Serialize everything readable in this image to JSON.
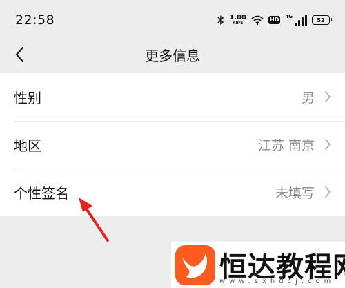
{
  "status_bar": {
    "time": "22:58",
    "net_speed_value": "1.00",
    "net_speed_unit": "KB/S",
    "hd_label": "HD",
    "network_type": "4G",
    "battery_level": "52",
    "icons": [
      "bluetooth-icon",
      "wifi-icon",
      "signal-icon",
      "battery-icon"
    ]
  },
  "nav": {
    "title": "更多信息",
    "back_icon": "chevron-left-icon"
  },
  "settings": [
    {
      "label": "性别",
      "value": "男"
    },
    {
      "label": "地区",
      "value": "江苏 南京"
    },
    {
      "label": "个性签名",
      "value": "未填写"
    }
  ],
  "annotation": {
    "color": "#e8231c",
    "icon": "red-arrow-icon"
  },
  "watermark": {
    "name": "恒达教程网",
    "url": "www.sxhdcj.com",
    "logo_color": "#ff5a1f"
  }
}
